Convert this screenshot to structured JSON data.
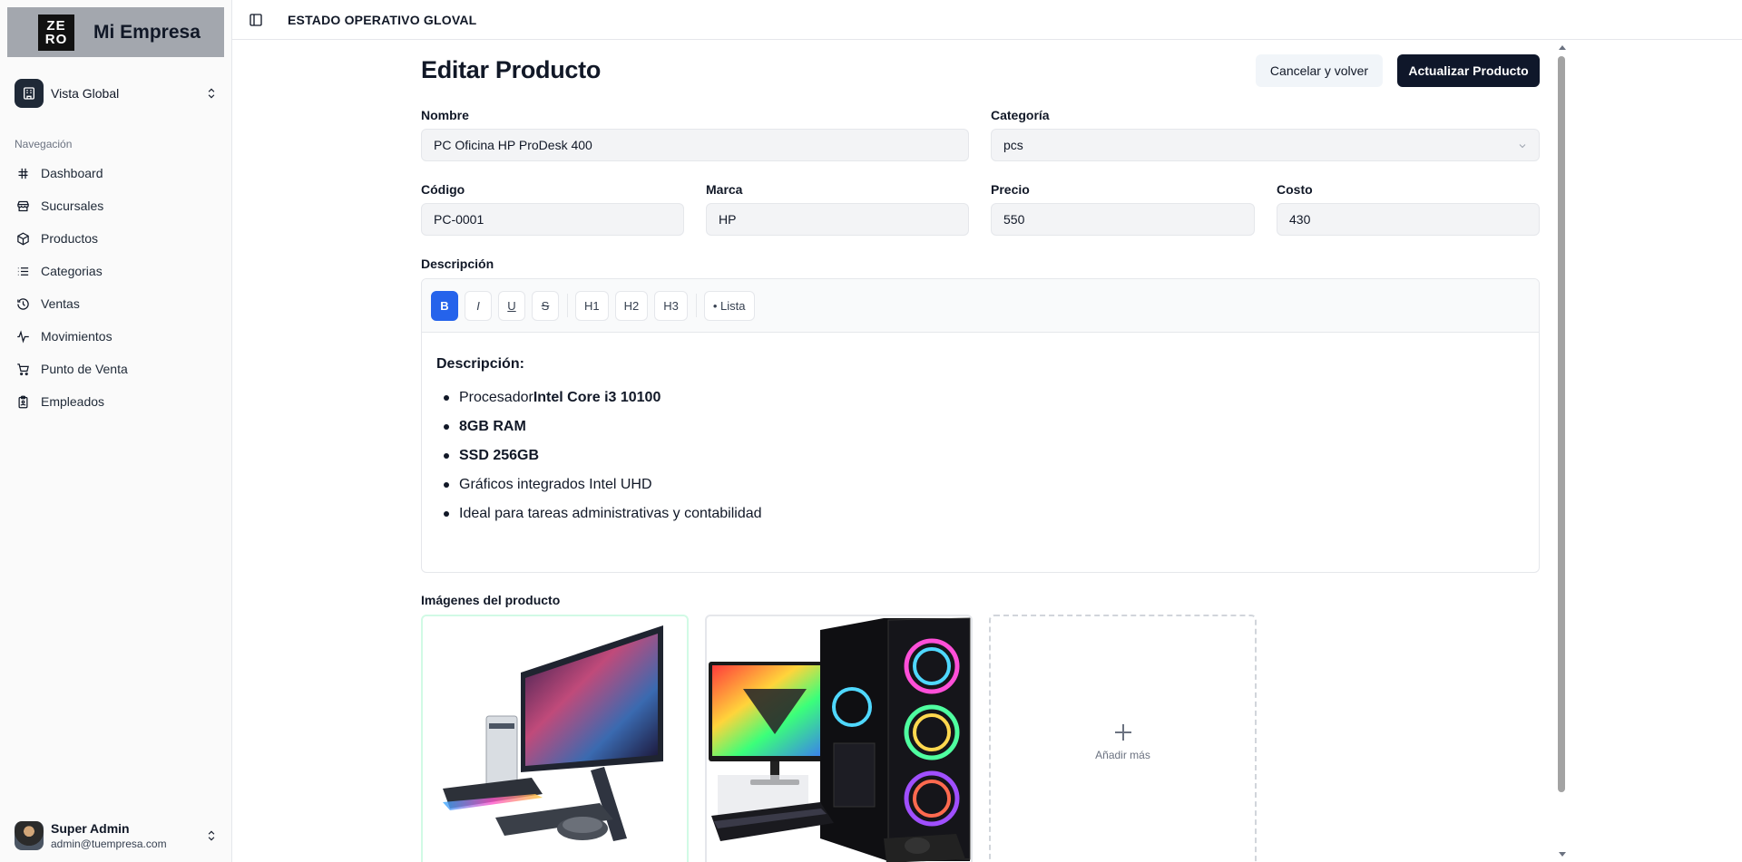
{
  "sidebar": {
    "brand_logo_line1": "ZE",
    "brand_logo_line2": "RO",
    "brand_name": "Mi Empresa",
    "switcher_label": "Vista Global",
    "section_label": "Navegación",
    "items": [
      {
        "label": "Dashboard",
        "icon": "grid-hash-icon"
      },
      {
        "label": "Sucursales",
        "icon": "store-icon"
      },
      {
        "label": "Productos",
        "icon": "package-icon"
      },
      {
        "label": "Categorias",
        "icon": "list-icon"
      },
      {
        "label": "Ventas",
        "icon": "history-icon"
      },
      {
        "label": "Movimientos",
        "icon": "activity-icon"
      },
      {
        "label": "Punto de Venta",
        "icon": "cart-icon"
      },
      {
        "label": "Empleados",
        "icon": "clipboard-icon"
      }
    ],
    "user": {
      "name": "Super Admin",
      "email": "admin@tuempresa.com"
    }
  },
  "topbar": {
    "title": "ESTADO OPERATIVO GLOVAL"
  },
  "page": {
    "title": "Editar Producto",
    "cancel_label": "Cancelar y volver",
    "submit_label": "Actualizar Producto"
  },
  "form": {
    "nombre": {
      "label": "Nombre",
      "value": "PC Oficina HP ProDesk 400"
    },
    "categoria": {
      "label": "Categoría",
      "value": "pcs"
    },
    "codigo": {
      "label": "Código",
      "value": "PC-0001"
    },
    "marca": {
      "label": "Marca",
      "value": "HP"
    },
    "precio": {
      "label": "Precio",
      "value": "550"
    },
    "costo": {
      "label": "Costo",
      "value": "430"
    },
    "descripcion_label": "Descripción"
  },
  "editor": {
    "toolbar": {
      "bold": "B",
      "italic": "I",
      "underline": "U",
      "strike": "S",
      "h1": "H1",
      "h2": "H2",
      "h3": "H3",
      "list": "• Lista"
    },
    "heading": "Descripción:",
    "bullets": [
      {
        "plain": "Procesador ",
        "bold": "Intel Core i3 10100"
      },
      {
        "plain": "",
        "bold": "8GB RAM"
      },
      {
        "plain": "",
        "bold": "SSD 256GB"
      },
      {
        "plain": "Gráficos integrados Intel UHD",
        "bold": ""
      },
      {
        "plain": "Ideal para tareas administrativas y contabilidad",
        "bold": ""
      }
    ]
  },
  "images": {
    "label": "Imágenes del producto",
    "add_label": "Añadir más"
  },
  "colors": {
    "primary": "#0f172a",
    "accent": "#2563eb",
    "brand_bg": "#a3a7ae"
  }
}
